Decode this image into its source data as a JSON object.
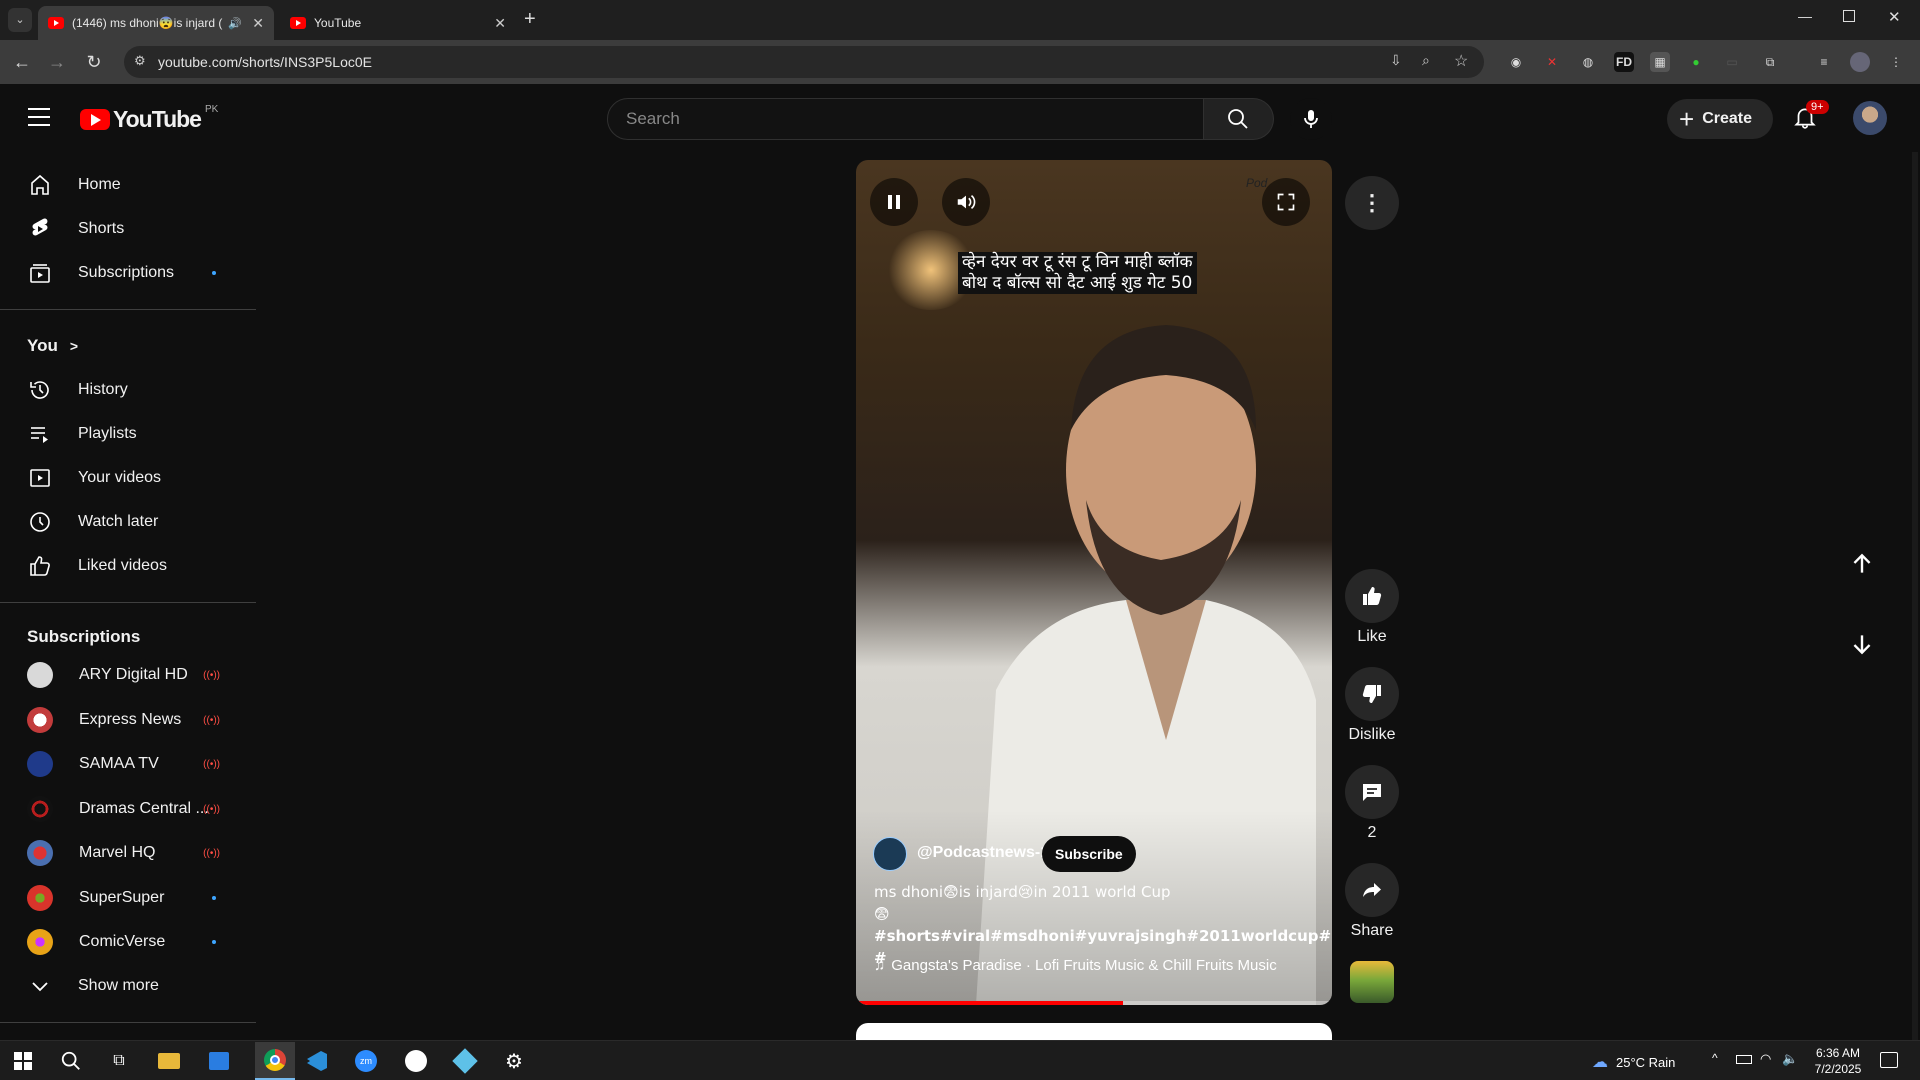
{
  "browser": {
    "tabs": [
      {
        "label": "(1446) ms dhoni😨is injard ("
      },
      {
        "label": "YouTube"
      }
    ],
    "url": "youtube.com/shorts/INS3P5Loc0E"
  },
  "header": {
    "logo_text": "YouTube",
    "country": "PK",
    "search_placeholder": "Search",
    "create_label": "Create",
    "notifications_badge": "9+"
  },
  "sidebar": {
    "main": [
      {
        "label": "Home",
        "icon": "home-icon"
      },
      {
        "label": "Shorts",
        "icon": "shorts-icon"
      },
      {
        "label": "Subscriptions",
        "icon": "subscriptions-icon"
      }
    ],
    "you_heading": "You",
    "you_items": [
      {
        "label": "History",
        "icon": "history-icon"
      },
      {
        "label": "Playlists",
        "icon": "playlists-icon"
      },
      {
        "label": "Your videos",
        "icon": "your-videos-icon"
      },
      {
        "label": "Watch later",
        "icon": "watch-later-icon"
      },
      {
        "label": "Liked videos",
        "icon": "liked-videos-icon"
      }
    ],
    "subs_heading": "Subscriptions",
    "subscriptions": [
      {
        "label": "ARY Digital HD",
        "status": "live",
        "color": "#d9d9d9"
      },
      {
        "label": "Express News",
        "status": "live",
        "color": "#c23b3b"
      },
      {
        "label": "SAMAA TV",
        "status": "live",
        "color": "#1f3a8a"
      },
      {
        "label": "Dramas Central ...",
        "status": "live",
        "color": "#b81d1d"
      },
      {
        "label": "Marvel HQ",
        "status": "live",
        "color": "#4a6fb0"
      },
      {
        "label": "SuperSuper",
        "status": "new",
        "color": "#d9342b"
      },
      {
        "label": "ComicVerse",
        "status": "new",
        "color": "#e8a317"
      }
    ],
    "show_more": "Show more"
  },
  "short": {
    "caption_line1": "व्हेन देयर वर टू रंस टू विन माही ब्लॉक",
    "caption_line2": "बोथ द बॉल्स सो दैट आई शुड गेट 50",
    "watermark": "Pod",
    "channel": "@Podcastnews-1",
    "subscribe_label": "Subscribe",
    "title_line1": "ms dhoni😨is injard😢in 2011 world Cup",
    "title_line2": "😨#shorts#viral#msdhoni#yuvrajsingh#2011worldcup#injard",
    "title_line3": "#",
    "music": "Gangsta's Paradise · Lofi Fruits Music & Chill Fruits Music",
    "progress": 0.56
  },
  "actions": {
    "like": "Like",
    "dislike": "Dislike",
    "comments": "2",
    "share": "Share"
  },
  "taskbar": {
    "weather": "25°C  Rain",
    "time": "6:36 AM",
    "date": "7/2/2025"
  }
}
